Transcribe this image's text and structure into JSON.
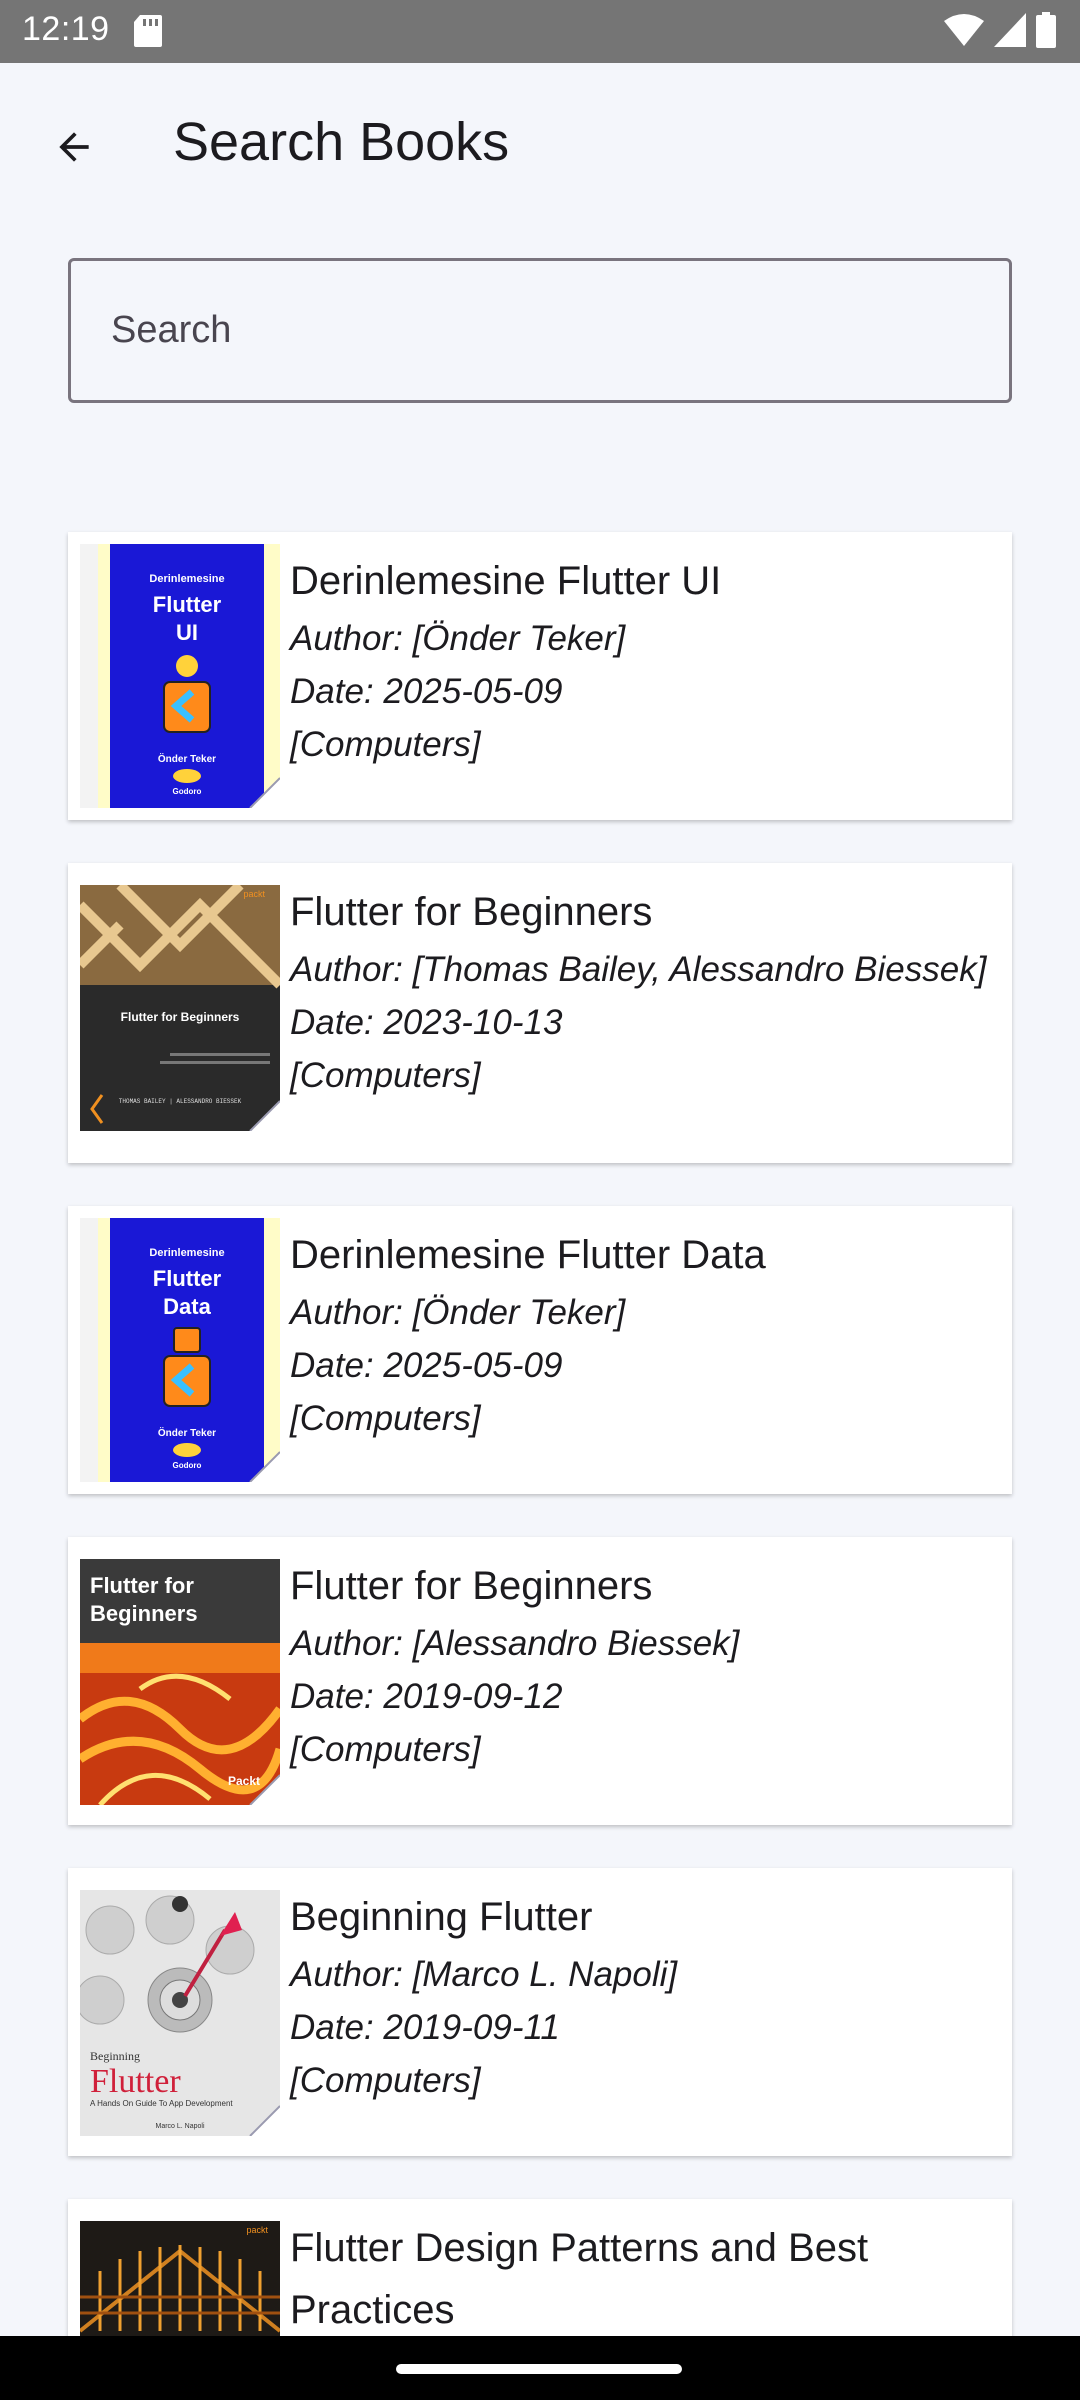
{
  "status_bar": {
    "time": "12:19"
  },
  "app_bar": {
    "title": "Search Books"
  },
  "search": {
    "placeholder": "Search",
    "value": ""
  },
  "books": [
    {
      "title": "Derinlemesine Flutter UI",
      "author": "Author: [Önder Teker]",
      "date": "Date: 2025-05-09",
      "category": "[Computers]",
      "cover_text": {
        "top": "Derinlemesine",
        "main1": "Flutter",
        "main2": "UI",
        "author": "Önder Teker",
        "publisher": "Godoro"
      }
    },
    {
      "title": "Flutter for Beginners",
      "author": "Author: [Thomas Bailey, Alessandro Biessek]",
      "date": "Date: 2023-10-13",
      "category": "[Computers]",
      "cover_text": {
        "main1": "Flutter for Beginners",
        "authors": "THOMAS BAILEY | ALESSANDRO BIESSEK",
        "publisher": "packt"
      }
    },
    {
      "title": "Derinlemesine Flutter Data",
      "author": "Author: [Önder Teker]",
      "date": "Date: 2025-05-09",
      "category": "[Computers]",
      "cover_text": {
        "top": "Derinlemesine",
        "main1": "Flutter",
        "main2": "Data",
        "author": "Önder Teker",
        "publisher": "Godoro"
      }
    },
    {
      "title": "Flutter for Beginners",
      "author": "Author: [Alessandro Biessek]",
      "date": "Date: 2019-09-12",
      "category": "[Computers]",
      "cover_text": {
        "main1": "Flutter for",
        "main2": "Beginners",
        "publisher": "Packt"
      }
    },
    {
      "title": "Beginning Flutter",
      "author": "Author: [Marco L. Napoli]",
      "date": "Date: 2019-09-11",
      "category": "[Computers]",
      "cover_text": {
        "top": "Beginning",
        "main1": "Flutter",
        "sub": "A Hands On Guide To App Development",
        "author": "Marco L. Napoli"
      }
    },
    {
      "title": "Flutter Design Patterns and Best Practices",
      "author": "",
      "date": "",
      "category": "",
      "cover_text": {
        "publisher": "packt"
      }
    }
  ],
  "colors": {
    "background": "#f4f6fb",
    "status_bar": "#757575",
    "card": "#ffffff",
    "outline": "#79747e"
  }
}
